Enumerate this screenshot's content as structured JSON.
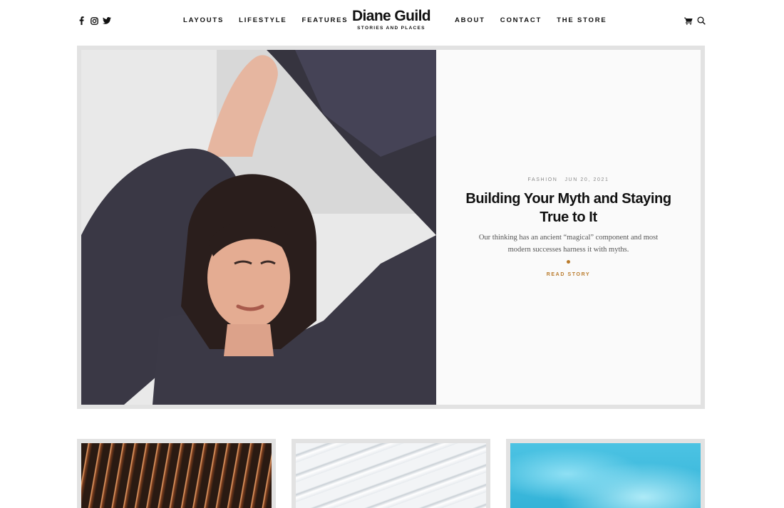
{
  "header": {
    "social": [
      {
        "name": "facebook-icon",
        "glyph": "f"
      },
      {
        "name": "instagram-icon",
        "glyph": ""
      },
      {
        "name": "twitter-icon",
        "glyph": ""
      }
    ],
    "nav_left": [
      "LAYOUTS",
      "LIFESTYLE",
      "FEATURES"
    ],
    "brand": {
      "name": "Diane Guild",
      "tagline": "STORIES AND PLACES"
    },
    "nav_right": [
      "ABOUT",
      "CONTACT",
      "THE STORE"
    ],
    "tools": [
      "cart-icon",
      "search-icon"
    ]
  },
  "hero": {
    "category": "FASHION",
    "date": "JUN 20, 2021",
    "title": "Building Your Myth and Staying True to It",
    "excerpt": "Our thinking has an ancient “magical” component and most modern successes harness it with myths.",
    "cta": "READ STORY",
    "accent": "#b97a2a"
  },
  "cards": [
    {
      "image": "escalator-lights-photo"
    },
    {
      "image": "white-roof-structure-photo"
    },
    {
      "image": "pool-water-photo"
    }
  ]
}
